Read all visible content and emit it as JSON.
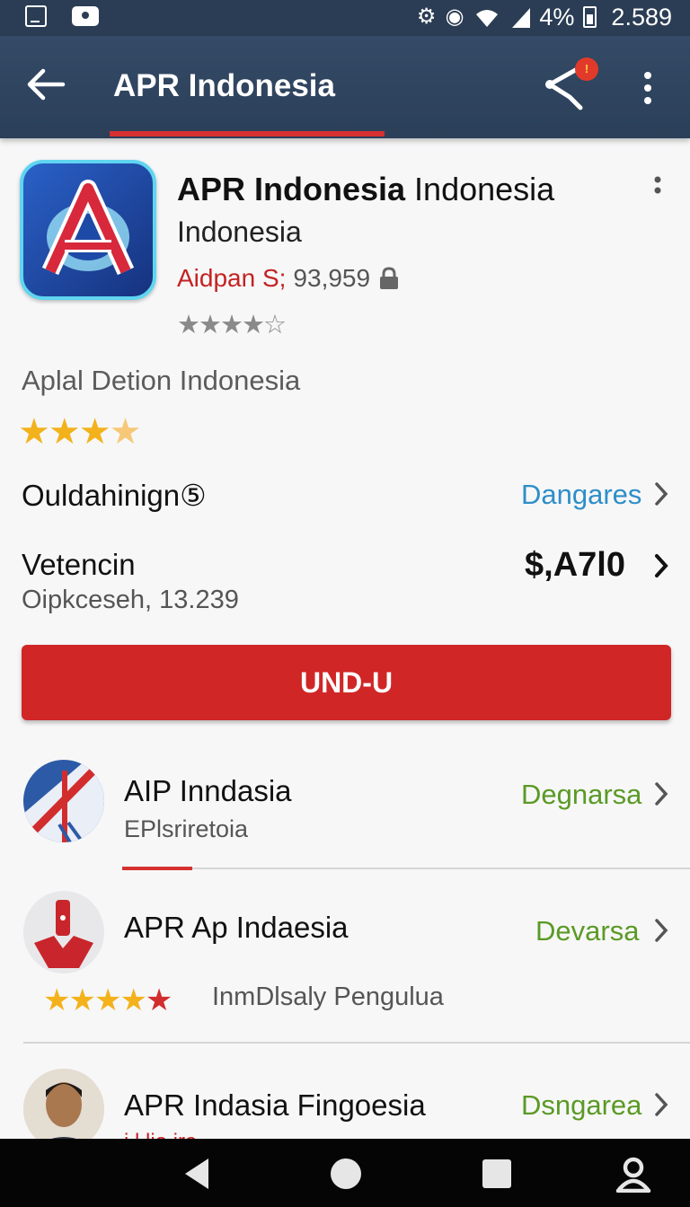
{
  "status_bar": {
    "battery": "4%",
    "time": "2.589",
    "icons": [
      "screenshot-icon",
      "photo-icon",
      "brightness-icon",
      "eye-icon",
      "wifi-icon",
      "signal-icon",
      "battery-icon"
    ]
  },
  "app_bar": {
    "title": "APR Indonesia",
    "share_badge": "!",
    "icons": [
      "back-arrow-icon",
      "share-icon",
      "overflow-menu-icon"
    ],
    "accent_color": "#d63030",
    "background": "#2f4460"
  },
  "app": {
    "name_bold": "APR Indonesia",
    "name_rest": " Indonesia",
    "subtitle": "Indonesia",
    "developer": "Aidpan S;",
    "downloads": "93,959",
    "grey_stars": "★★★★☆",
    "description": "Aplal Detion Indonesia",
    "gold_stars_full": "★★★",
    "gold_stars_partial": "★"
  },
  "rows": {
    "row1_label": "Ouldahinign⑤",
    "row1_link": "Dangares",
    "row2_label": "Vetencin",
    "row2_price": "$,A7l0",
    "row2_sub": "Oipkceseh, 13.239"
  },
  "cta": {
    "label": "UND-U",
    "color": "#d02626"
  },
  "list": [
    {
      "title": "AIP Inndasia",
      "subtitle": "EPlsriretoia",
      "action": "Degnarsa"
    },
    {
      "title": "APR Ap Indaesia",
      "rating_text": "InmDlsaly Pengulua",
      "stars": "★★★★",
      "star_red": "★",
      "action": "Devarsa"
    },
    {
      "title": "APR Indasia Fingoesia",
      "action": "Dsngarea",
      "peek": "i.l.lio.ira"
    }
  ],
  "nav_bar": {
    "icons": [
      "back-triangle-icon",
      "home-circle-icon",
      "recents-square-icon",
      "profile-icon"
    ]
  }
}
